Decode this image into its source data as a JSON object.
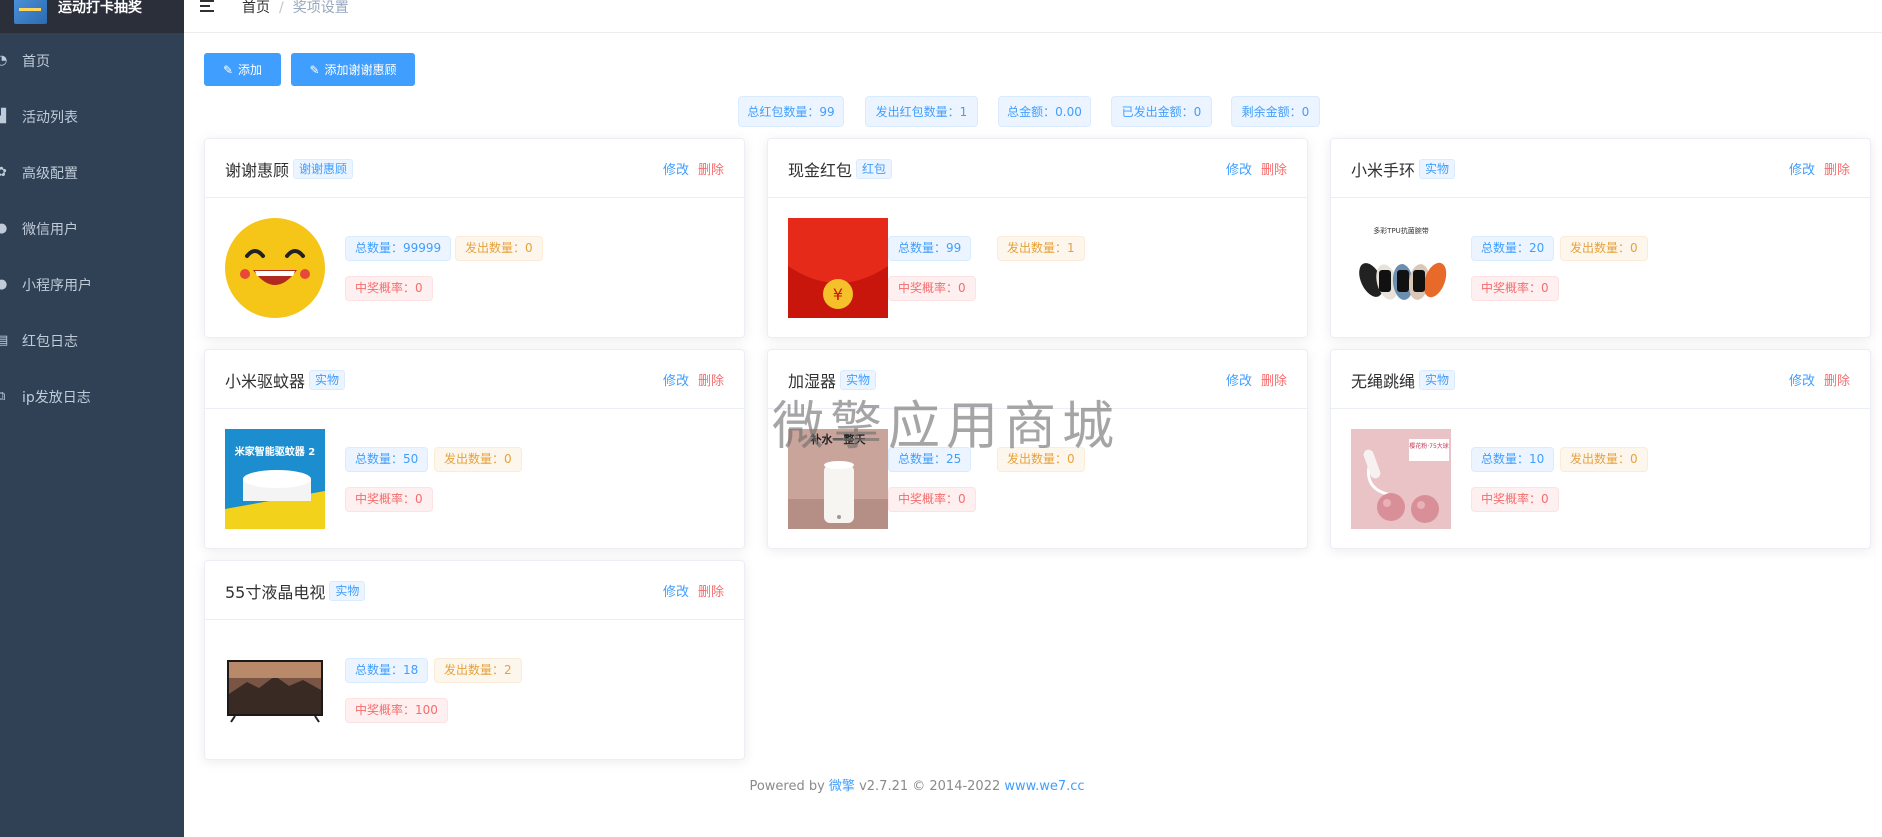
{
  "app": {
    "title": "运动打卡抽奖"
  },
  "sidebar": {
    "items": [
      {
        "label": "首页",
        "icon": "dashboard-icon"
      },
      {
        "label": "活动列表",
        "icon": "list-icon"
      },
      {
        "label": "高级配置",
        "icon": "gear-icon"
      },
      {
        "label": "微信用户",
        "icon": "user-icon"
      },
      {
        "label": "小程序用户",
        "icon": "user-icon"
      },
      {
        "label": "红包日志",
        "icon": "document-icon"
      },
      {
        "label": "ip发放日志",
        "icon": "external-link-icon"
      }
    ]
  },
  "breadcrumb": {
    "home": "首页",
    "sep": "/",
    "current": "奖项设置"
  },
  "toolbar": {
    "add_label": "添加",
    "add_thanks_label": "添加谢谢惠顾"
  },
  "stats": [
    {
      "label": "总红包数量：99"
    },
    {
      "label": "发出红包数量：1"
    },
    {
      "label": "总金额：0.00"
    },
    {
      "label": "已发出金额：0"
    },
    {
      "label": "剩余金额：0"
    }
  ],
  "prizes": [
    {
      "name": "谢谢惠顾",
      "type": "谢谢惠顾",
      "edit": "修改",
      "delete": "删除",
      "total": "总数量：99999",
      "sent": "发出数量：0",
      "prob": "中奖概率：0",
      "image": "smiley-face"
    },
    {
      "name": "现金红包",
      "type": "红包",
      "edit": "修改",
      "delete": "删除",
      "total": "总数量：99",
      "sent": "发出数量：1",
      "prob": "中奖概率：0",
      "image": "red-envelope"
    },
    {
      "name": "小米手环",
      "type": "实物",
      "edit": "修改",
      "delete": "删除",
      "total": "总数量：20",
      "sent": "发出数量：0",
      "prob": "中奖概率：0",
      "image": "smart-band",
      "image_caption": "多彩TPU抗菌腕带"
    },
    {
      "name": "小米驱蚊器",
      "type": "实物",
      "edit": "修改",
      "delete": "删除",
      "total": "总数量：50",
      "sent": "发出数量：0",
      "prob": "中奖概率：0",
      "image": "mosquito-repeller",
      "image_caption": "米家智能驱蚊器 2"
    },
    {
      "name": "加湿器",
      "type": "实物",
      "edit": "修改",
      "delete": "删除",
      "total": "总数量：25",
      "sent": "发出数量：0",
      "prob": "中奖概率：0",
      "image": "humidifier",
      "image_caption": "补水一整天"
    },
    {
      "name": "无绳跳绳",
      "type": "实物",
      "edit": "修改",
      "delete": "删除",
      "total": "总数量：10",
      "sent": "发出数量：0",
      "prob": "中奖概率：0",
      "image": "jump-rope",
      "image_caption": "樱花粉·75大球"
    },
    {
      "name": "55寸液晶电视",
      "type": "实物",
      "edit": "修改",
      "delete": "删除",
      "total": "总数量：18",
      "sent": "发出数量：2",
      "prob": "中奖概率：100",
      "image": "tv"
    }
  ],
  "watermark": "微擎应用商城",
  "footer": {
    "prefix": "Powered by ",
    "brand": "微擎",
    "middle": " v2.7.21 © 2014-2022 ",
    "link": "www.we7.cc"
  },
  "colors": {
    "sidebar_bg": "#304156",
    "primary": "#409eff",
    "danger": "#f56c6c",
    "warning": "#e6a23c"
  }
}
